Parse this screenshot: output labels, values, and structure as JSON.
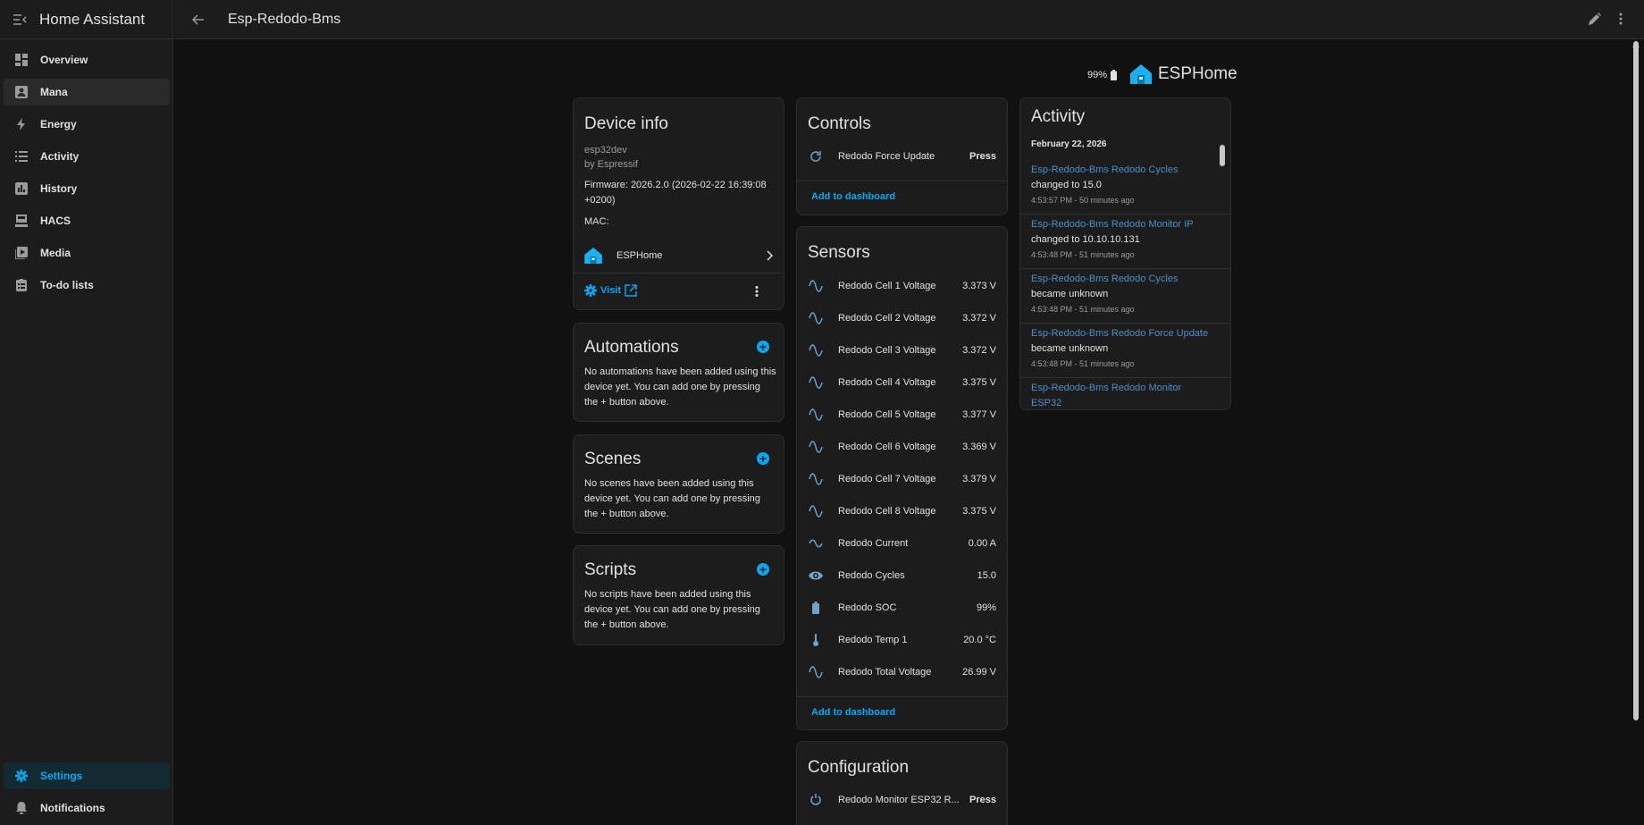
{
  "sidebar": {
    "title": "Home Assistant",
    "items": [
      {
        "label": "Overview",
        "icon": "dashboard-icon"
      },
      {
        "label": "Mana",
        "icon": "account-box-icon"
      },
      {
        "label": "Energy",
        "icon": "lightning-icon"
      },
      {
        "label": "Activity",
        "icon": "list-icon"
      },
      {
        "label": "History",
        "icon": "chart-box-icon"
      },
      {
        "label": "HACS",
        "icon": "hacs-icon"
      },
      {
        "label": "Media",
        "icon": "play-box-icon"
      },
      {
        "label": "To-do lists",
        "icon": "clipboard-list-icon"
      }
    ],
    "settings_label": "Settings",
    "notifications_label": "Notifications"
  },
  "header": {
    "title": "Esp-Redodo-Bms"
  },
  "badge": {
    "battery": "99%",
    "brand": "ESPHome"
  },
  "device_info": {
    "title": "Device info",
    "model": "esp32dev",
    "manufacturer": "by Espressif",
    "firmware": "Firmware: 2026.2.0 (2026-02-22 16:39:08 +0200)",
    "mac": "MAC:",
    "integration": "ESPHome",
    "visit": "Visit"
  },
  "automations": {
    "title": "Automations",
    "text": "No automations have been added using this device yet. You can add one by pressing the + button above."
  },
  "scenes": {
    "title": "Scenes",
    "text": "No scenes have been added using this device yet. You can add one by pressing the + button above."
  },
  "scripts": {
    "title": "Scripts",
    "text": "No scripts have been added using this device yet. You can add one by pressing the + button above."
  },
  "controls": {
    "title": "Controls",
    "items": [
      {
        "name": "Redodo Force Update",
        "value": "Press"
      }
    ],
    "add_to_dashboard": "Add to dashboard"
  },
  "sensors": {
    "title": "Sensors",
    "items": [
      {
        "name": "Redodo Cell 1 Voltage",
        "value": "3.373 V",
        "icon": "sine-wave-icon"
      },
      {
        "name": "Redodo Cell 2 Voltage",
        "value": "3.372 V",
        "icon": "sine-wave-icon"
      },
      {
        "name": "Redodo Cell 3 Voltage",
        "value": "3.372 V",
        "icon": "sine-wave-icon"
      },
      {
        "name": "Redodo Cell 4 Voltage",
        "value": "3.375 V",
        "icon": "sine-wave-icon"
      },
      {
        "name": "Redodo Cell 5 Voltage",
        "value": "3.377 V",
        "icon": "sine-wave-icon"
      },
      {
        "name": "Redodo Cell 6 Voltage",
        "value": "3.369 V",
        "icon": "sine-wave-icon"
      },
      {
        "name": "Redodo Cell 7 Voltage",
        "value": "3.379 V",
        "icon": "sine-wave-icon"
      },
      {
        "name": "Redodo Cell 8 Voltage",
        "value": "3.375 V",
        "icon": "sine-wave-icon"
      },
      {
        "name": "Redodo Current",
        "value": "0.00 A",
        "icon": "current-ac-icon"
      },
      {
        "name": "Redodo Cycles",
        "value": "15.0",
        "icon": "eye-icon"
      },
      {
        "name": "Redodo SOC",
        "value": "99%",
        "icon": "battery-icon"
      },
      {
        "name": "Redodo Temp 1",
        "value": "20.0 °C",
        "icon": "thermometer-icon"
      },
      {
        "name": "Redodo Total Voltage",
        "value": "26.99 V",
        "icon": "sine-wave-icon"
      }
    ],
    "add_to_dashboard": "Add to dashboard"
  },
  "configuration": {
    "title": "Configuration",
    "items": [
      {
        "name": "Redodo Monitor ESP32 R...",
        "value": "Press"
      }
    ]
  },
  "activity": {
    "title": "Activity",
    "date": "February 22, 2026",
    "entries": [
      {
        "entity": "Esp-Redodo-Bms Redodo Cycles",
        "message": "changed to 15.0",
        "time": "4:53:57 PM - 50 minutes ago"
      },
      {
        "entity": "Esp-Redodo-Bms Redodo Monitor IP",
        "message": "changed to 10.10.10.131",
        "time": "4:53:48 PM - 51 minutes ago"
      },
      {
        "entity": "Esp-Redodo-Bms Redodo Cycles",
        "message": "became unknown",
        "time": "4:53:48 PM - 51 minutes ago"
      },
      {
        "entity": "Esp-Redodo-Bms Redodo Force Update",
        "message": "became unknown",
        "time": "4:53:48 PM - 51 minutes ago"
      },
      {
        "entity": "Esp-Redodo-Bms Redodo Monitor ESP32",
        "message": "",
        "time": ""
      }
    ]
  },
  "colors": {
    "accent": "#03a9f4",
    "background": "#111111",
    "card": "#1c1c1c",
    "icon": "#6fa3c9"
  }
}
